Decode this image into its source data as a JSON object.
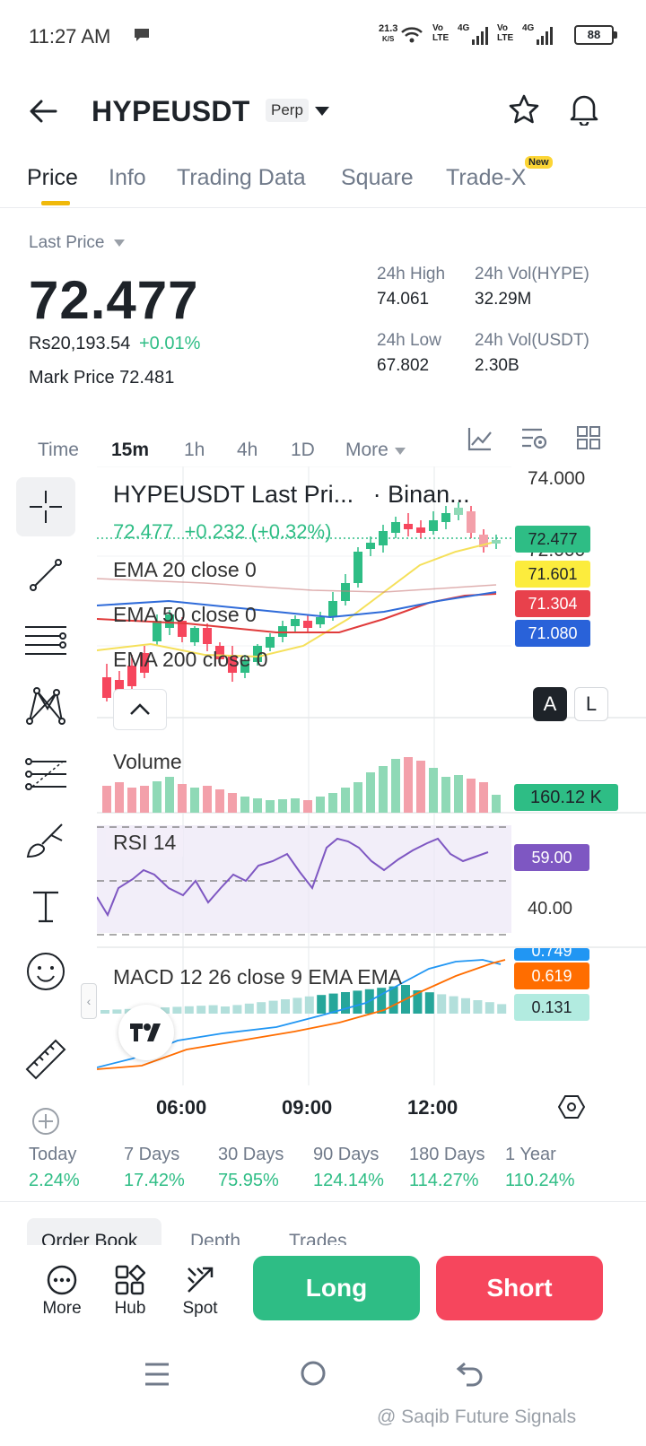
{
  "status_bar": {
    "time": "11:27 AM",
    "net_speed_value": "21.3",
    "net_speed_unit": "K/S",
    "sim1_top": "Vo",
    "sim1_bottom": "LTE",
    "sim1_gen": "4G",
    "sim2_top": "Vo",
    "sim2_bottom": "LTE",
    "sim2_gen": "4G",
    "battery": "88"
  },
  "header": {
    "symbol": "HYPEUSDT",
    "badge": "Perp"
  },
  "tabs": [
    {
      "label": "Price"
    },
    {
      "label": "Info"
    },
    {
      "label": "Trading Data"
    },
    {
      "label": "Square"
    },
    {
      "label": "Trade-X"
    }
  ],
  "new_badge": "New",
  "price_panel": {
    "last_price_label": "Last Price",
    "last_price": "72.477",
    "fiat_price": "Rs20,193.54",
    "change": "+0.01%",
    "mark_price_label": "Mark Price",
    "mark_price": "72.481",
    "high_label": "24h High",
    "high": "74.061",
    "low_label": "24h Low",
    "low": "67.802",
    "vol_base_label": "24h Vol(HYPE)",
    "vol_base": "32.29M",
    "vol_quote_label": "24h Vol(USDT)",
    "vol_quote": "2.30B"
  },
  "timeframes": [
    "Time",
    "15m",
    "1h",
    "4h",
    "1D",
    "More"
  ],
  "chart": {
    "legend_title": "HYPEUSDT Last Pri...",
    "legend_source": "· Binan...",
    "legend_price_line": "72.477  +0.232 (+0.32%)",
    "ema20": "EMA 20 close 0",
    "ema50": "EMA 50 close 0",
    "ema200": "EMA 200 close 0",
    "y_top": "74.000",
    "y_partial": "72.000",
    "price_label_last": "72.477",
    "price_label_ema20": "71.601",
    "price_label_ema50": "71.304",
    "price_label_ema200": "71.080",
    "btn_auto": "A",
    "btn_log": "L",
    "volume_label": "Volume",
    "volume_value": "160.12 K",
    "rsi_label": "RSI 14",
    "rsi_value": "59.00",
    "rsi_level": "40.00",
    "macd_label": "MACD 12 26 close 9 EMA EMA",
    "macd_partial": "0.749",
    "macd_value1": "0.619",
    "macd_value2": "0.131",
    "x_ticks": [
      "06:00",
      "09:00",
      "12:00"
    ],
    "colors": {
      "up": "#2ebd85",
      "down": "#f6465d",
      "ema20": "#f5e05a",
      "ema50": "#e03b3b",
      "ema200": "#2f6bd9",
      "rsi": "#7e57c2",
      "macd_line": "#2196f3",
      "signal_line": "#ff6d00"
    }
  },
  "chart_data": {
    "type": "candlestick",
    "title": "HYPEUSDT Last Pri...",
    "x_ticks": [
      "06:00",
      "09:00",
      "12:00"
    ],
    "y_ticks": [
      "74.000",
      "72.000"
    ],
    "last_price": 72.477,
    "ema20": 71.601,
    "ema50": 71.304,
    "ema200": 71.08,
    "volume_last": "160.12 K",
    "rsi_last": 59.0,
    "rsi_levels": [
      40.0
    ],
    "macd_values": [
      0.619,
      0.131
    ]
  },
  "period_returns": [
    {
      "label": "Today",
      "value": "2.24%"
    },
    {
      "label": "7 Days",
      "value": "17.42%"
    },
    {
      "label": "30 Days",
      "value": "75.95%"
    },
    {
      "label": "90 Days",
      "value": "124.14%"
    },
    {
      "label": "180 Days",
      "value": "114.27%"
    },
    {
      "label": "1 Year",
      "value": "110.24%"
    }
  ],
  "sub_tabs": [
    "Order Book",
    "Depth",
    "Trades"
  ],
  "bottom_bar": {
    "more": "More",
    "hub": "Hub",
    "spot": "Spot",
    "long": "Long",
    "short": "Short"
  },
  "watermark": "@ Saqib Future Signals"
}
